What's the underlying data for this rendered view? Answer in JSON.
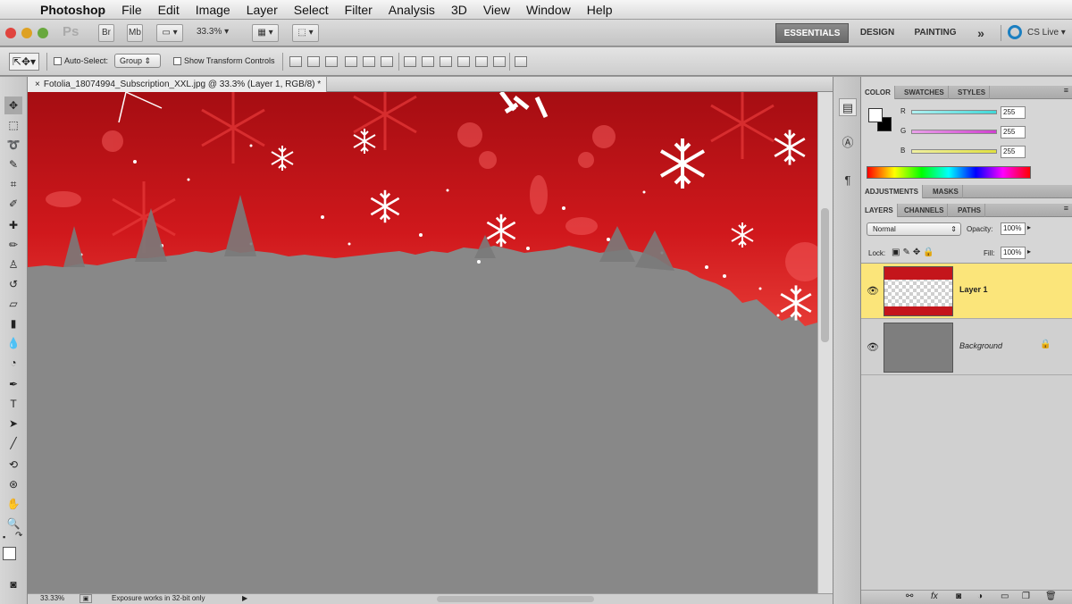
{
  "menubar": {
    "app": "Photoshop",
    "items": [
      "File",
      "Edit",
      "Image",
      "Layer",
      "Select",
      "Filter",
      "Analysis",
      "3D",
      "View",
      "Window",
      "Help"
    ]
  },
  "appbar": {
    "ps": "Ps",
    "br": "Br",
    "mb": "Mb",
    "zoom": "33.3%",
    "workspaces": [
      "ESSENTIALS",
      "DESIGN",
      "PAINTING"
    ],
    "more": "»",
    "cslive": "CS Live"
  },
  "options": {
    "auto_select_label": "Auto-Select:",
    "auto_select_value": "Group",
    "show_transform_label": "Show Transform Controls"
  },
  "document": {
    "tab_title": "Fotolia_18074994_Subscription_XXL.jpg @ 33.3% (Layer 1, RGB/8) *"
  },
  "status": {
    "zoom": "33.33%",
    "info": "Exposure works in 32-bit only"
  },
  "color_panel": {
    "tabs": [
      "COLOR",
      "SWATCHES",
      "STYLES"
    ],
    "channels": [
      {
        "label": "R",
        "value": "255",
        "color": "#40d8d8"
      },
      {
        "label": "G",
        "value": "255",
        "color": "#d040d0"
      },
      {
        "label": "B",
        "value": "255",
        "color": "#e0e040"
      }
    ]
  },
  "adjust_panel": {
    "tabs": [
      "ADJUSTMENTS",
      "MASKS"
    ]
  },
  "layers_panel": {
    "tabs": [
      "LAYERS",
      "CHANNELS",
      "PATHS"
    ],
    "blend_mode": "Normal",
    "opacity_label": "Opacity:",
    "opacity": "100%",
    "lock_label": "Lock:",
    "fill_label": "Fill:",
    "fill": "100%",
    "layers": [
      {
        "name": "Layer 1",
        "selected": true
      },
      {
        "name": "Background",
        "selected": false
      }
    ]
  },
  "colors": {
    "canvas_red": "#c4151b",
    "canvas_gray": "#888888",
    "selected_layer": "#fbe57a"
  }
}
